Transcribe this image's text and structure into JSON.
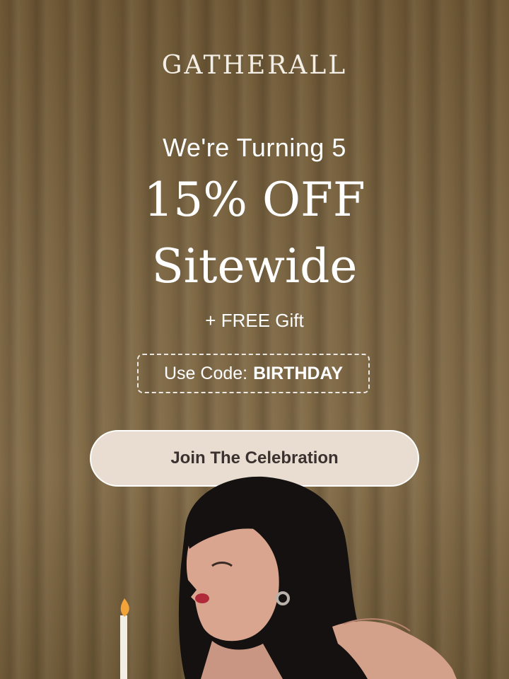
{
  "brand": {
    "logo_text": "GATHERALL"
  },
  "promo": {
    "subtitle": "We're Turning 5",
    "headline_line1": "15% OFF",
    "headline_line2": "Sitewide",
    "gift_text": "+ FREE Gift",
    "code_label": "Use Code:",
    "code_value": "BIRTHDAY"
  },
  "cta": {
    "label": "Join The Celebration"
  },
  "colors": {
    "background": "#7a6442",
    "cta_background": "#e8ddd0",
    "cta_text": "#3b3230",
    "text": "#ffffff"
  },
  "image": {
    "description_icon": "woman-blowing-candle-photo"
  }
}
